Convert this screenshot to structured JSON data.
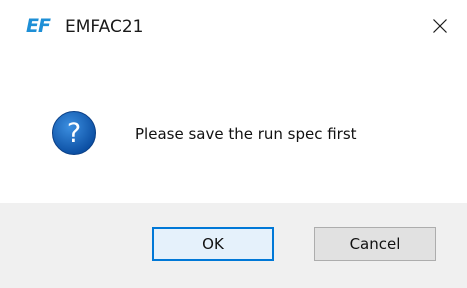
{
  "window": {
    "logo_text": "EF",
    "title": "EMFAC21",
    "close_glyph": "×"
  },
  "dialog": {
    "icon": "question-icon",
    "message": "Please save the run spec first"
  },
  "buttons": {
    "ok_label": "OK",
    "cancel_label": "Cancel"
  },
  "colors": {
    "accent": "#0078d7",
    "logo": "#1e8fd6",
    "icon_fill": "#1565c0",
    "footer_bg": "#f0f0f0"
  }
}
